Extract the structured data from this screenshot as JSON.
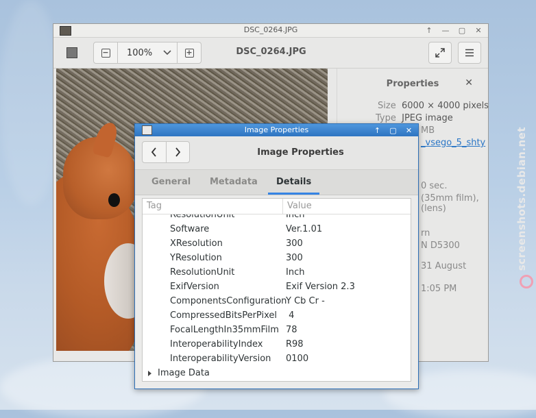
{
  "viewer": {
    "title": "DSC_0264.JPG",
    "header_title": "DSC_0264.JPG",
    "zoom_value": "100%"
  },
  "properties": {
    "heading": "Properties",
    "rows": [
      {
        "label": "Size",
        "value": "6000 × 4000 pixels"
      },
      {
        "label": "Type",
        "value": "JPEG image"
      },
      {
        "label": "",
        "value": "MB"
      },
      {
        "label": "",
        "value": "_vsego_5_shty"
      },
      {
        "label": "",
        "value": "0 sec."
      },
      {
        "label": "",
        "value": "(35mm film),"
      },
      {
        "label": "",
        "value": "(lens)"
      },
      {
        "label": "",
        "value": "rn"
      },
      {
        "label": "",
        "value": "N D5300"
      },
      {
        "label": "",
        "value": "31 August"
      },
      {
        "label": "",
        "value": "1:05 PM"
      }
    ]
  },
  "dialog": {
    "title": "Image Properties",
    "header_title": "Image Properties",
    "tabs": [
      {
        "label": "General",
        "active": false
      },
      {
        "label": "Metadata",
        "active": false
      },
      {
        "label": "Details",
        "active": true
      }
    ],
    "columns": {
      "tag": "Tag",
      "value": "Value"
    },
    "rows": [
      {
        "tag": "ResolutionUnit",
        "value": "Inch"
      },
      {
        "tag": "Software",
        "value": "Ver.1.01"
      },
      {
        "tag": "XResolution",
        "value": "300"
      },
      {
        "tag": "YResolution",
        "value": "300"
      },
      {
        "tag": "ResolutionUnit",
        "value": "Inch"
      },
      {
        "tag": "ExifVersion",
        "value": "Exif Version 2.3"
      },
      {
        "tag": "ComponentsConfiguration",
        "value": "Y Cb Cr -"
      },
      {
        "tag": "CompressedBitsPerPixel",
        "value": " 4"
      },
      {
        "tag": "FocalLengthIn35mmFilm",
        "value": "78"
      },
      {
        "tag": "InteroperabilityIndex",
        "value": "R98"
      },
      {
        "tag": "InteroperabilityVersion",
        "value": "0100"
      }
    ],
    "group_row": "Image Data"
  },
  "watermark": "screenshots.debian.net",
  "colors": {
    "dialog_titlebar": "#2e74c1",
    "active_tab": "#3584e4",
    "link": "#2a76c6"
  }
}
